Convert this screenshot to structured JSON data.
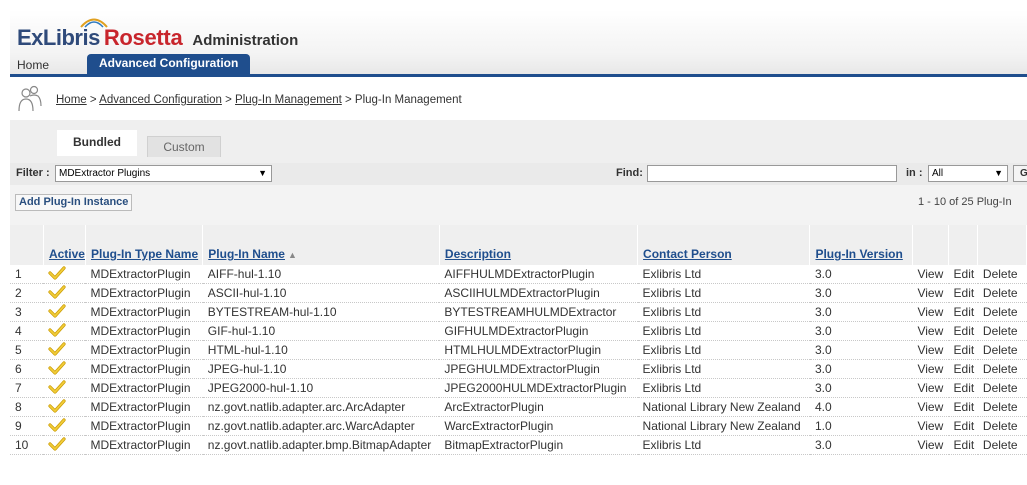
{
  "header": {
    "logo_ex": "ExLibris",
    "logo_rosetta": "Rosetta",
    "logo_admin": "Administration",
    "tabs": [
      {
        "label": "Home"
      },
      {
        "label": "Advanced Configuration"
      }
    ]
  },
  "breadcrumb": {
    "items": [
      "Home",
      "Advanced Configuration",
      "Plug-In Management"
    ],
    "current": "Plug-In Management"
  },
  "subtabs": [
    {
      "label": "Bundled",
      "active": true
    },
    {
      "label": "Custom",
      "active": false
    }
  ],
  "filter": {
    "label": "Filter :",
    "selected": "MDExtractor Plugins",
    "find_label": "Find:",
    "find_value": "",
    "in_label": "in :",
    "in_selected": "All",
    "go_label": "Go"
  },
  "toolbar": {
    "add_label": "Add Plug-In Instance",
    "range_text": "1 - 10 of 25 Plug-In"
  },
  "table": {
    "headers": [
      "Active",
      "Plug-In Type Name",
      "Plug-In Name",
      "Description",
      "Contact Person",
      "Plug-In Version"
    ],
    "actions": [
      "View",
      "Edit",
      "Delete"
    ],
    "rows": [
      {
        "n": "1",
        "type": "MDExtractorPlugin",
        "name": "AIFF-hul-1.10",
        "desc": "AIFFHULMDExtractorPlugin",
        "contact": "Exlibris Ltd",
        "version": "3.0"
      },
      {
        "n": "2",
        "type": "MDExtractorPlugin",
        "name": "ASCII-hul-1.10",
        "desc": "ASCIIHULMDExtractorPlugin",
        "contact": "Exlibris Ltd",
        "version": "3.0"
      },
      {
        "n": "3",
        "type": "MDExtractorPlugin",
        "name": "BYTESTREAM-hul-1.10",
        "desc": "BYTESTREAMHULMDExtractor",
        "contact": "Exlibris Ltd",
        "version": "3.0"
      },
      {
        "n": "4",
        "type": "MDExtractorPlugin",
        "name": "GIF-hul-1.10",
        "desc": "GIFHULMDExtractorPlugin",
        "contact": "Exlibris Ltd",
        "version": "3.0"
      },
      {
        "n": "5",
        "type": "MDExtractorPlugin",
        "name": "HTML-hul-1.10",
        "desc": "HTMLHULMDExtractorPlugin",
        "contact": "Exlibris Ltd",
        "version": "3.0"
      },
      {
        "n": "6",
        "type": "MDExtractorPlugin",
        "name": "JPEG-hul-1.10",
        "desc": "JPEGHULMDExtractorPlugin",
        "contact": "Exlibris Ltd",
        "version": "3.0"
      },
      {
        "n": "7",
        "type": "MDExtractorPlugin",
        "name": "JPEG2000-hul-1.10",
        "desc": "JPEG2000HULMDExtractorPlugin",
        "contact": "Exlibris Ltd",
        "version": "3.0"
      },
      {
        "n": "8",
        "type": "MDExtractorPlugin",
        "name": "nz.govt.natlib.adapter.arc.ArcAdapter",
        "desc": "ArcExtractorPlugin",
        "contact": "National Library New Zealand",
        "version": "4.0"
      },
      {
        "n": "9",
        "type": "MDExtractorPlugin",
        "name": "nz.govt.natlib.adapter.arc.WarcAdapter",
        "desc": "WarcExtractorPlugin",
        "contact": "National Library New Zealand",
        "version": "1.0"
      },
      {
        "n": "10",
        "type": "MDExtractorPlugin",
        "name": "nz.govt.natlib.adapter.bmp.BitmapAdapter",
        "desc": "BitmapExtractorPlugin",
        "contact": "Exlibris Ltd",
        "version": "3.0"
      }
    ]
  },
  "colors": {
    "brand_blue": "#1f4e8d",
    "brand_red": "#c8252c",
    "check_yellow": "#e8b800"
  },
  "icons": {
    "active": "checkmark-icon",
    "breadcrumb": "people-icon"
  }
}
